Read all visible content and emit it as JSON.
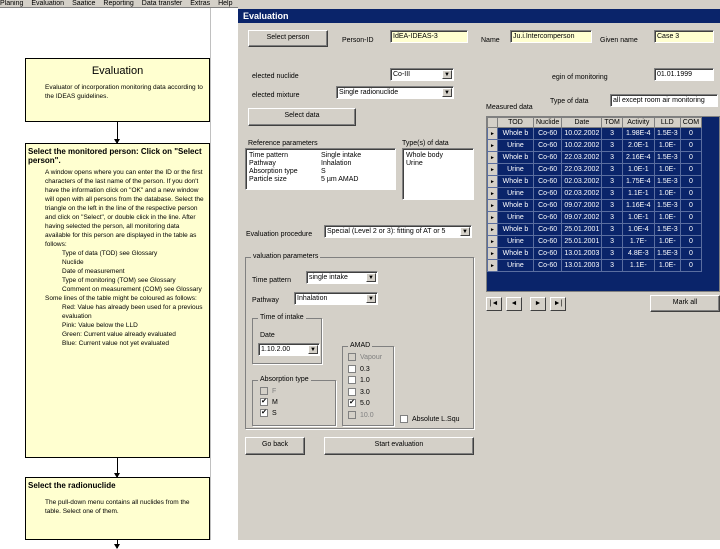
{
  "menu": [
    "Planing",
    "Evaluation",
    "Saatice",
    "Reporting",
    "Data transfer",
    "Extras",
    "Help"
  ],
  "flow": {
    "box1": {
      "title": "Evaluation",
      "text": "Evaluator of incorporation monitoring data according to the IDEAS guidelines."
    },
    "box2": {
      "title": "Select the monitored person: Click on \"Select person\".",
      "paras": [
        "A window opens where you can enter the ID or the first characters of the last name of the person. If you don't have the information click on \"OK\" and a new window will open with all persons from the database. Select the triangle on the left in the line of the respective person and click on \"Select\", or double click in the line. After having selected the person, all monitoring data available for this person are displayed in the table as follows:"
      ],
      "items": [
        "Type of data (TOD) see Glossary",
        "Nuclide",
        "Date of measurement",
        "Type of monitoring (TOM) see Glossary",
        "Comment on measurement (COM) see Glossary"
      ],
      "after": "Some lines of the table might be coloured as follows:",
      "colors": [
        "Red: Value has already been used for a previous evaluation",
        "Pink: Value below the LLD",
        "Green: Current value already evaluated",
        "Blue: Current value not yet evaluated"
      ]
    },
    "box3": {
      "title": "Select the radionuclide",
      "text": "The pull-down menu contains all nuclides from the table. Select one of them."
    }
  },
  "app": {
    "title": "Evaluation",
    "select_person_btn": "Select person",
    "person_id_label": "Person-ID",
    "person_id_value": "IdEA-IDEAS-3",
    "name_label": "Name",
    "name_value": "Ju.i.Intercomperson",
    "given_name_label": "Given name",
    "given_name_value": "Case 3",
    "selected_nuclide_label": "elected nuclide",
    "selected_nuclide_value": "Co-III",
    "selected_mixture_label": "elected mixture",
    "selected_mixture_value": "Single radionuclide",
    "begin_monitoring_label": "egin of monitoring",
    "begin_monitoring_value": "01.01.1999",
    "measured_data_label": "Measured data",
    "type_of_data_label": "Type of data",
    "type_of_data_value": "all except room air monitoring",
    "select_data_btn": "Select data",
    "reference_params_label": "Reference parameters",
    "reference_params": [
      [
        "Time pattern",
        "Single intake"
      ],
      [
        "Pathway",
        "Inhalation"
      ],
      [
        "Absorption type",
        "S"
      ],
      [
        "Particle size",
        "5 µm AMAD"
      ]
    ],
    "types_of_data_label": "Type(s) of data",
    "types_of_data": [
      "Whole body",
      "Urine"
    ],
    "eval_procedure_label": "Evaluation procedure",
    "eval_procedure_value": "Special (Level 2 or 3): fitting of AT or 5",
    "eval_params_title": "valuation parameters",
    "time_pattern_label": "Time pattern",
    "time_pattern_value": "single intake",
    "pathway_label": "Pathway",
    "pathway_value": "Inhalation",
    "time_of_intake_title": "Time of intake",
    "date_label": "Date",
    "date_value": "1.10.2.00",
    "absorption_title": "Absorption type",
    "absorption": [
      {
        "label": "F",
        "checked": false,
        "disabled": true
      },
      {
        "label": "M",
        "checked": true,
        "disabled": false
      },
      {
        "label": "S",
        "checked": true,
        "disabled": false
      }
    ],
    "amad_title": "AMAD",
    "amad": [
      {
        "label": "Vapour",
        "checked": false,
        "disabled": true
      },
      {
        "label": "0.3",
        "checked": false,
        "disabled": false
      },
      {
        "label": "1.0",
        "checked": false,
        "disabled": false
      },
      {
        "label": "3.0",
        "checked": false,
        "disabled": false
      },
      {
        "label": "5.0",
        "checked": true,
        "disabled": false
      },
      {
        "label": "10.0",
        "checked": false,
        "disabled": true
      }
    ],
    "absolute_chk": "Absolute L.Squ",
    "go_back_btn": "Go back",
    "start_eval_btn": "Start evaluation",
    "mark_all_btn": "Mark all",
    "table": {
      "columns": [
        "TOD",
        "Nuclide",
        "Date",
        "TOM",
        "Activity",
        "LLD",
        "COM"
      ],
      "rows": [
        [
          "Whole b",
          "Co-60",
          "10.02.2002",
          "3",
          "1.98E-4",
          "1.5E-3",
          "0"
        ],
        [
          "Urine",
          "Co-60",
          "10.02.2002",
          "3",
          "2.0E-1",
          "1.0E-",
          "0"
        ],
        [
          "Whole b",
          "Co-60",
          "22.03.2002",
          "3",
          "2.16E-4",
          "1.5E-3",
          "0"
        ],
        [
          "Urine",
          "Co-60",
          "22.03.2002",
          "3",
          "1.0E-1",
          "1.0E-",
          "0"
        ],
        [
          "Whole b",
          "Co-60",
          "02.03.2002",
          "3",
          "1.75E-4",
          "1.5E-3",
          "0"
        ],
        [
          "Urine",
          "Co-60",
          "02.03.2002",
          "3",
          "1.1E-1",
          "1.0E-",
          "0"
        ],
        [
          "Whole b",
          "Co-60",
          "09.07.2002",
          "3",
          "1.16E-4",
          "1.5E-3",
          "0"
        ],
        [
          "Urine",
          "Co-60",
          "09.07.2002",
          "3",
          "1.0E-1",
          "1.0E-",
          "0"
        ],
        [
          "Whole b",
          "Co-60",
          "25.01.2001",
          "3",
          "1.0E-4",
          "1.5E-3",
          "0"
        ],
        [
          "Urine",
          "Co-60",
          "25.01.2001",
          "3",
          "1.7E-",
          "1.0E-",
          "0"
        ],
        [
          "Whole b",
          "Co-60",
          "13.01.2003",
          "3",
          "4.8E-3",
          "1.5E-3",
          "0"
        ],
        [
          "Urine",
          "Co-60",
          "13.01.2003",
          "3",
          "1.1E-",
          "1.0E-",
          "0"
        ]
      ]
    },
    "nav": [
      "|◄",
      "◄",
      "►",
      "►|"
    ]
  },
  "colors": {
    "titlebar": "#0a246a",
    "panel": "#d4d0c8",
    "flowbox": "#ffffd0",
    "grid_bg": "#0a246a"
  }
}
